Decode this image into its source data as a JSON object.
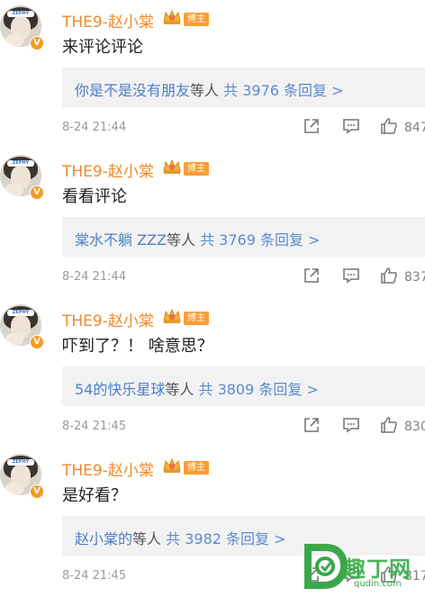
{
  "comments": [
    {
      "username": "THE9-赵小棠",
      "tag": "博主",
      "verified": "V",
      "text": "来评论评论",
      "reply_who": "你是不是没有朋友",
      "reply_mid": "等人",
      "reply_count": "共 3976 条回复 >",
      "time": "8-24 21:44",
      "likes": "847"
    },
    {
      "username": "THE9-赵小棠",
      "tag": "博主",
      "verified": "V",
      "text": "看看评论",
      "reply_who": "棠水不躺 ZZZ",
      "reply_mid": "等人",
      "reply_count": "共 3769 条回复 >",
      "time": "8-24 21:44",
      "likes": "837"
    },
    {
      "username": "THE9-赵小棠",
      "tag": "博主",
      "verified": "V",
      "text": "吓到了？！ 啥意思？",
      "reply_who": "54的快乐星球",
      "reply_mid": "等人",
      "reply_count": "共 3809 条回复 >",
      "time": "8-24 21:45",
      "likes": "830"
    },
    {
      "username": "THE9-赵小棠",
      "tag": "博主",
      "verified": "V",
      "text": "是好看？",
      "reply_who": "赵小棠的",
      "reply_mid": "等人",
      "reply_count": "共 3982 条回复 >",
      "time": "8-24 21:45",
      "likes": "817"
    }
  ],
  "avatar_band_text": "ZEPHY",
  "watermark": {
    "brand": "趣丁网",
    "url": "qudin.com"
  },
  "colors": {
    "name": "#ee8a2c",
    "reply_link": "#5a8ad2",
    "tag_bg": "#f79e38",
    "watermark": "#40b050"
  }
}
